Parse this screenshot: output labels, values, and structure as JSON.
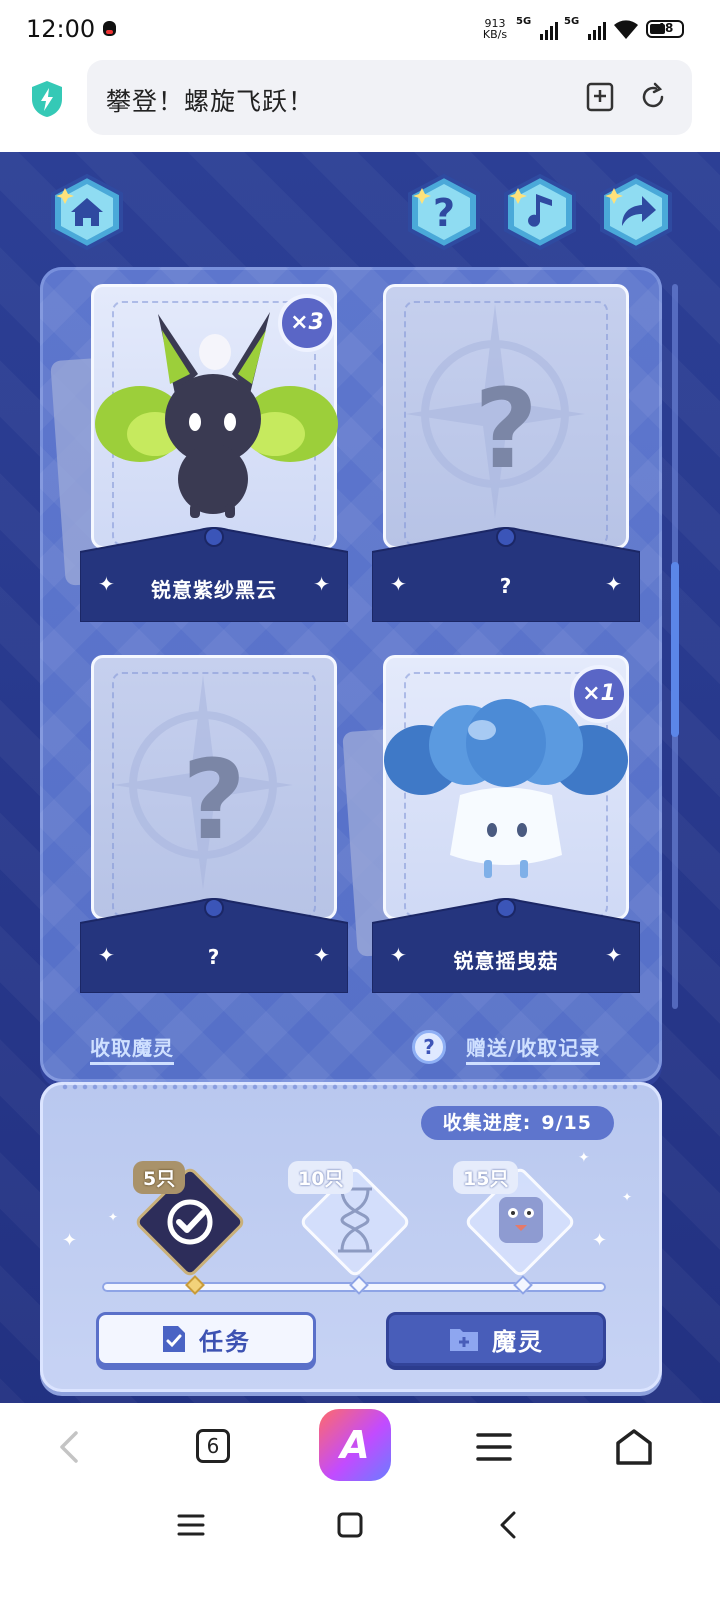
{
  "status_bar": {
    "time": "12:00",
    "net_speed_value": "913",
    "net_speed_unit": "KB/s",
    "signal1_label": "5G",
    "signal2_label": "5G",
    "battery": "48",
    "icons": [
      "qq-icon",
      "signal-icon",
      "wifi-icon",
      "battery-icon"
    ]
  },
  "browser": {
    "page_title": "攀登！螺旋飞跃！",
    "tab_count": "6",
    "center_logo": "A",
    "icons": [
      "shield-icon",
      "bookmark-add-icon",
      "reload-icon"
    ]
  },
  "game": {
    "top_buttons": [
      "home-icon",
      "help-icon",
      "music-icon",
      "share-icon"
    ],
    "cards": [
      {
        "name": "锐意紫纱黑云",
        "badge": "×3",
        "unlocked": true
      },
      {
        "name": "?",
        "badge": "",
        "unlocked": false
      },
      {
        "name": "?",
        "badge": "",
        "unlocked": false
      },
      {
        "name": "锐意摇曳菇",
        "badge": "×1",
        "unlocked": true
      }
    ],
    "question_mark": "?",
    "links": {
      "collect": "收取魔灵",
      "help_glyph": "?",
      "records": "赠送/收取记录"
    },
    "progress": {
      "label": "收集进度:",
      "value": "9/15",
      "current": 9,
      "total": 15,
      "milestones": [
        {
          "label": "5只",
          "reached": true
        },
        {
          "label": "10只",
          "reached": false
        },
        {
          "label": "15只",
          "reached": false
        }
      ]
    },
    "buttons": {
      "task": "任务",
      "spirit": "魔灵"
    }
  },
  "colors": {
    "game_bg": "#27378a",
    "panel": "#5670c8",
    "accent_light": "#cfe0ff",
    "button_dark": "#485db9"
  }
}
